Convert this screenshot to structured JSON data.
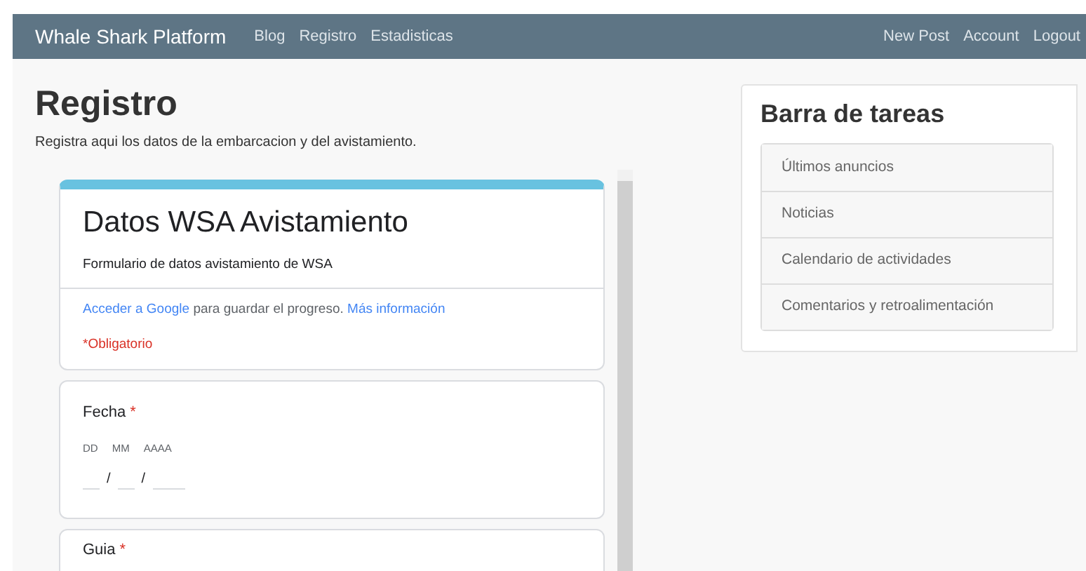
{
  "navbar": {
    "brand": "Whale Shark Platform",
    "left_links": [
      "Blog",
      "Registro",
      "Estadisticas"
    ],
    "right_links": [
      "New Post",
      "Account",
      "Logout"
    ]
  },
  "page": {
    "title": "Registro",
    "subtitle": "Registra aqui los datos de la embarcacion y del avistamiento."
  },
  "form": {
    "title": "Datos WSA Avistamiento",
    "description": "Formulario de datos avistamiento de WSA",
    "signin_link": "Acceder a Google",
    "signin_text": "para guardar el progreso.",
    "more_link": "Más información",
    "required_note": "*Obligatorio",
    "questions": [
      {
        "kind": "date",
        "label": "Fecha",
        "required_mark": "*",
        "parts": [
          "DD",
          "MM",
          "AAAA"
        ],
        "separators": [
          "/",
          "/"
        ]
      },
      {
        "kind": "text",
        "label": "Guia",
        "required_mark": "*"
      }
    ]
  },
  "sidebar": {
    "title": "Barra de tareas",
    "items": [
      "Últimos anuncios",
      "Noticias",
      "Calendario de actividades",
      "Comentarios y retroalimentación"
    ]
  }
}
